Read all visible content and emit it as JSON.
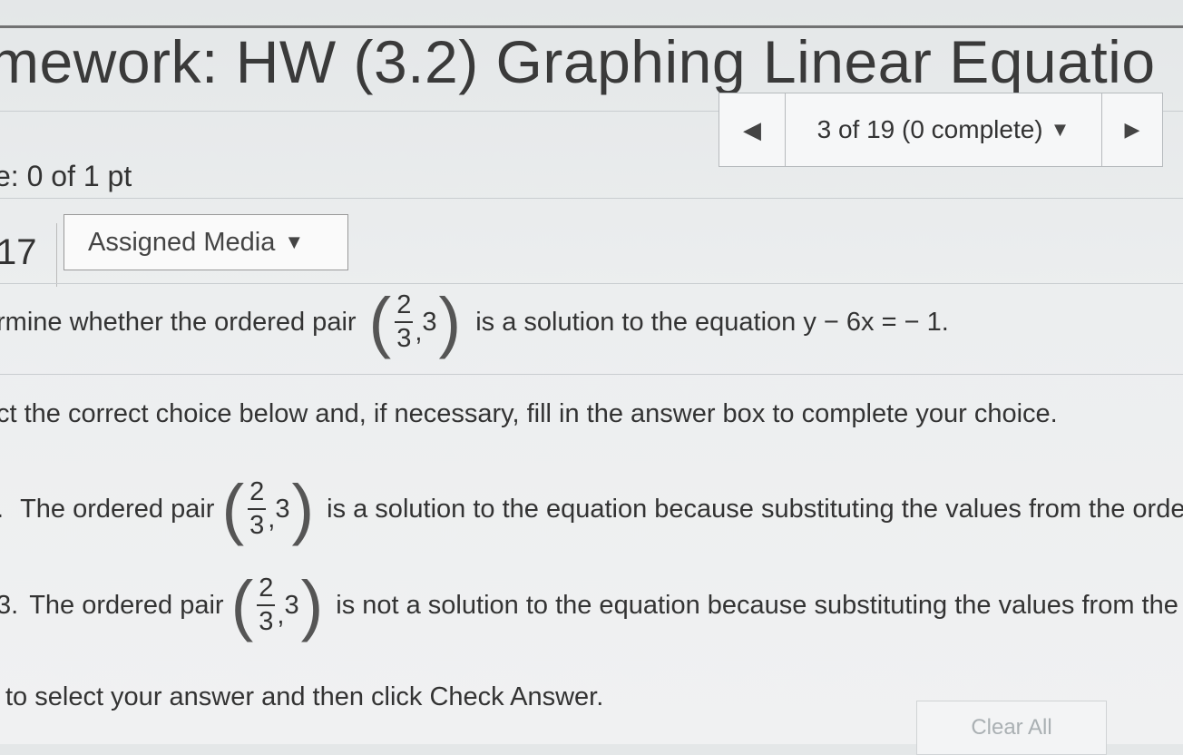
{
  "header": {
    "title": "mework: HW (3.2) Graphing Linear Equatio"
  },
  "score": "e: 0 of 1 pt",
  "pager": {
    "prev_icon": "left-triangle-icon",
    "status": "3 of 19 (0 complete)",
    "dropdown_icon": "caret-down-icon",
    "next_icon": "right-triangle-icon"
  },
  "question": {
    "number": "17",
    "media_label": "Assigned Media",
    "prompt_prefix": "rmine whether the ordered pair",
    "pair_num": "2",
    "pair_den": "3",
    "pair_y": "3",
    "pair_comma": ",",
    "prompt_suffix": "is a solution to the equation y − 6x = − 1.",
    "instruction": "ct the correct choice below and, if necessary, fill in the answer box to complete your choice."
  },
  "choices": [
    {
      "letter": ".",
      "prefix": "The ordered pair",
      "suffix": "is a solution to the equation because substituting the values from the ordere"
    },
    {
      "letter": "3.",
      "prefix": "The ordered pair",
      "suffix": "is not a solution to the equation because substituting the values from the o"
    }
  ],
  "footer": {
    "hint": "to select your answer and then click Check Answer.",
    "clear_label": "Clear All"
  }
}
